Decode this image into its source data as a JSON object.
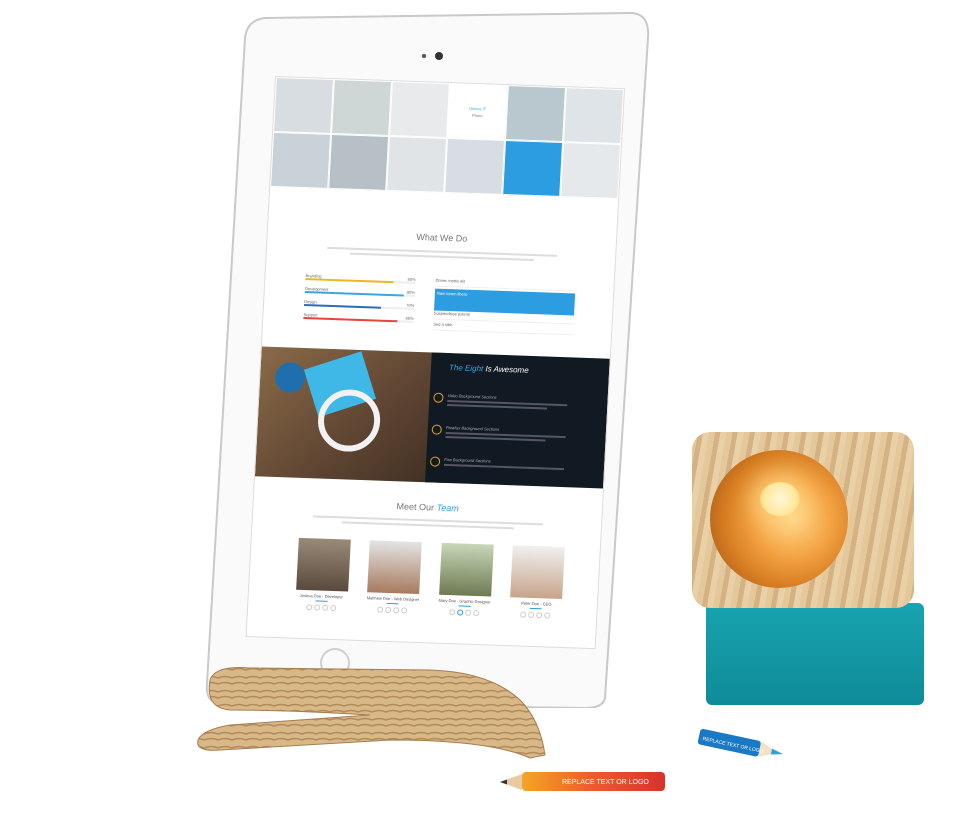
{
  "tablet_page": {
    "header_tile": {
      "title": "Unicus IT",
      "subtitle": "Photo"
    },
    "what_we_do": {
      "title": "What We Do",
      "skills": [
        {
          "label": "Branding",
          "value": "80%",
          "percent": 80,
          "color": "#f4b320"
        },
        {
          "label": "Development",
          "value": "90%",
          "percent": 90,
          "color": "#3ba7e0"
        },
        {
          "label": "Design",
          "value": "70%",
          "percent": 70,
          "color": "#2a6fb8"
        },
        {
          "label": "Support",
          "value": "85%",
          "percent": 85,
          "color": "#e8453c"
        }
      ],
      "accordion": [
        "Donec mattis elit",
        "Nam lorem libero",
        "Suspendisse potenti",
        "Sed a nibh"
      ]
    },
    "awesome": {
      "title_accent": "The Eight",
      "title_rest": "Is Awesome",
      "features": [
        {
          "title": "Video Background Sections"
        },
        {
          "title": "Parallax Background Sections"
        },
        {
          "title": "Fixe Background Sections"
        }
      ]
    },
    "team": {
      "title_plain": "Meet Our",
      "title_accent": "Team",
      "members": [
        {
          "name": "Joshua Doe - Developer"
        },
        {
          "name": "Matthew Doe - Web Designer"
        },
        {
          "name": "Mary Doe - Graphic Designer"
        },
        {
          "name": "Peter Doe - CEO"
        }
      ]
    }
  },
  "pencils": {
    "big_label": "REPLACE TEXT OR LOGO",
    "small_label": "REPLACE TEXT OR LOGO"
  },
  "colors": {
    "accent": "#2c9de0",
    "lamp_base": "#16a0ac",
    "wood": "#d9b887"
  }
}
